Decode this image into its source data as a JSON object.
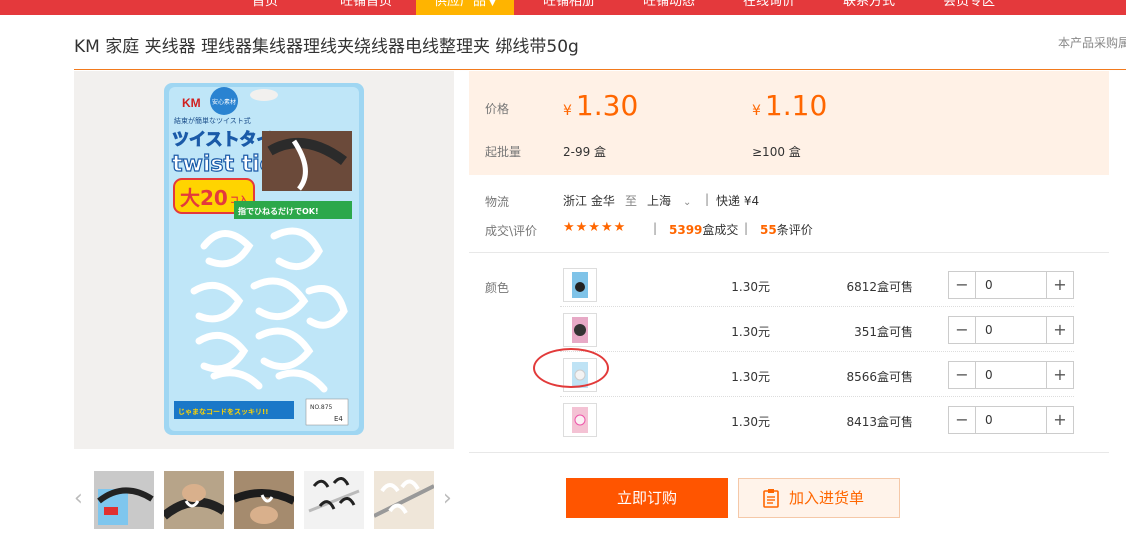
{
  "nav": {
    "items": [
      {
        "label": "首页"
      },
      {
        "label": "旺铺首页"
      },
      {
        "label": "供应产品"
      },
      {
        "label": "旺铺相册"
      },
      {
        "label": "旺铺动态"
      },
      {
        "label": "在线询价"
      },
      {
        "label": "联系方式"
      },
      {
        "label": "会员专区"
      }
    ],
    "active_index": 2
  },
  "product": {
    "title": "KM 家庭 夹线器 理线器集线器理线夹绕线器电线整理夹 绑线带50g",
    "notice": "本产品采购属"
  },
  "price": {
    "price_label": "价格",
    "currency": "¥",
    "tiers": [
      {
        "price": "1.30",
        "range": "2-99 盒"
      },
      {
        "price": "1.10",
        "range": "≥100 盒"
      }
    ],
    "moq_label": "起批量"
  },
  "logistics": {
    "label": "物流",
    "from_province": "浙江",
    "from_city": "金华",
    "to_word": "至",
    "to_city": "上海",
    "express": "快递 ¥4"
  },
  "deals": {
    "label": "成交\\评价",
    "stars": "★★★★★",
    "deal_count": "5399",
    "deal_unit": "盒成交",
    "review_count": "55",
    "review_unit": "条评价"
  },
  "sku": {
    "label": "颜色",
    "rows": [
      {
        "price": "1.30元",
        "stock": "6812",
        "stock_unit": "盒可售",
        "qty": "0"
      },
      {
        "price": "1.30元",
        "stock": "351",
        "stock_unit": "盒可售",
        "qty": "0"
      },
      {
        "price": "1.30元",
        "stock": "8566",
        "stock_unit": "盒可售",
        "qty": "0"
      },
      {
        "price": "1.30元",
        "stock": "8413",
        "stock_unit": "盒可售",
        "qty": "0"
      }
    ]
  },
  "package": {
    "brand": "KM",
    "badge": "安心素材",
    "jp_top": "結束が簡単なツイスト式",
    "jp_title": "ツイストタイ",
    "en_title": "twist tie",
    "count": "大20",
    "count_unit": "コ入",
    "slogan": "指でひねるだけでOK!",
    "bottom": "じゃまなコードをスッキリ!!",
    "code": "E4",
    "sku_no": "NO.875"
  },
  "actions": {
    "order": "立即订购",
    "cart": "加入进货单"
  },
  "colors": {
    "nav_bg": "#e4393c",
    "nav_active": "#ffb400",
    "accent": "#ff6600",
    "price_bg": "#fff1e6"
  }
}
